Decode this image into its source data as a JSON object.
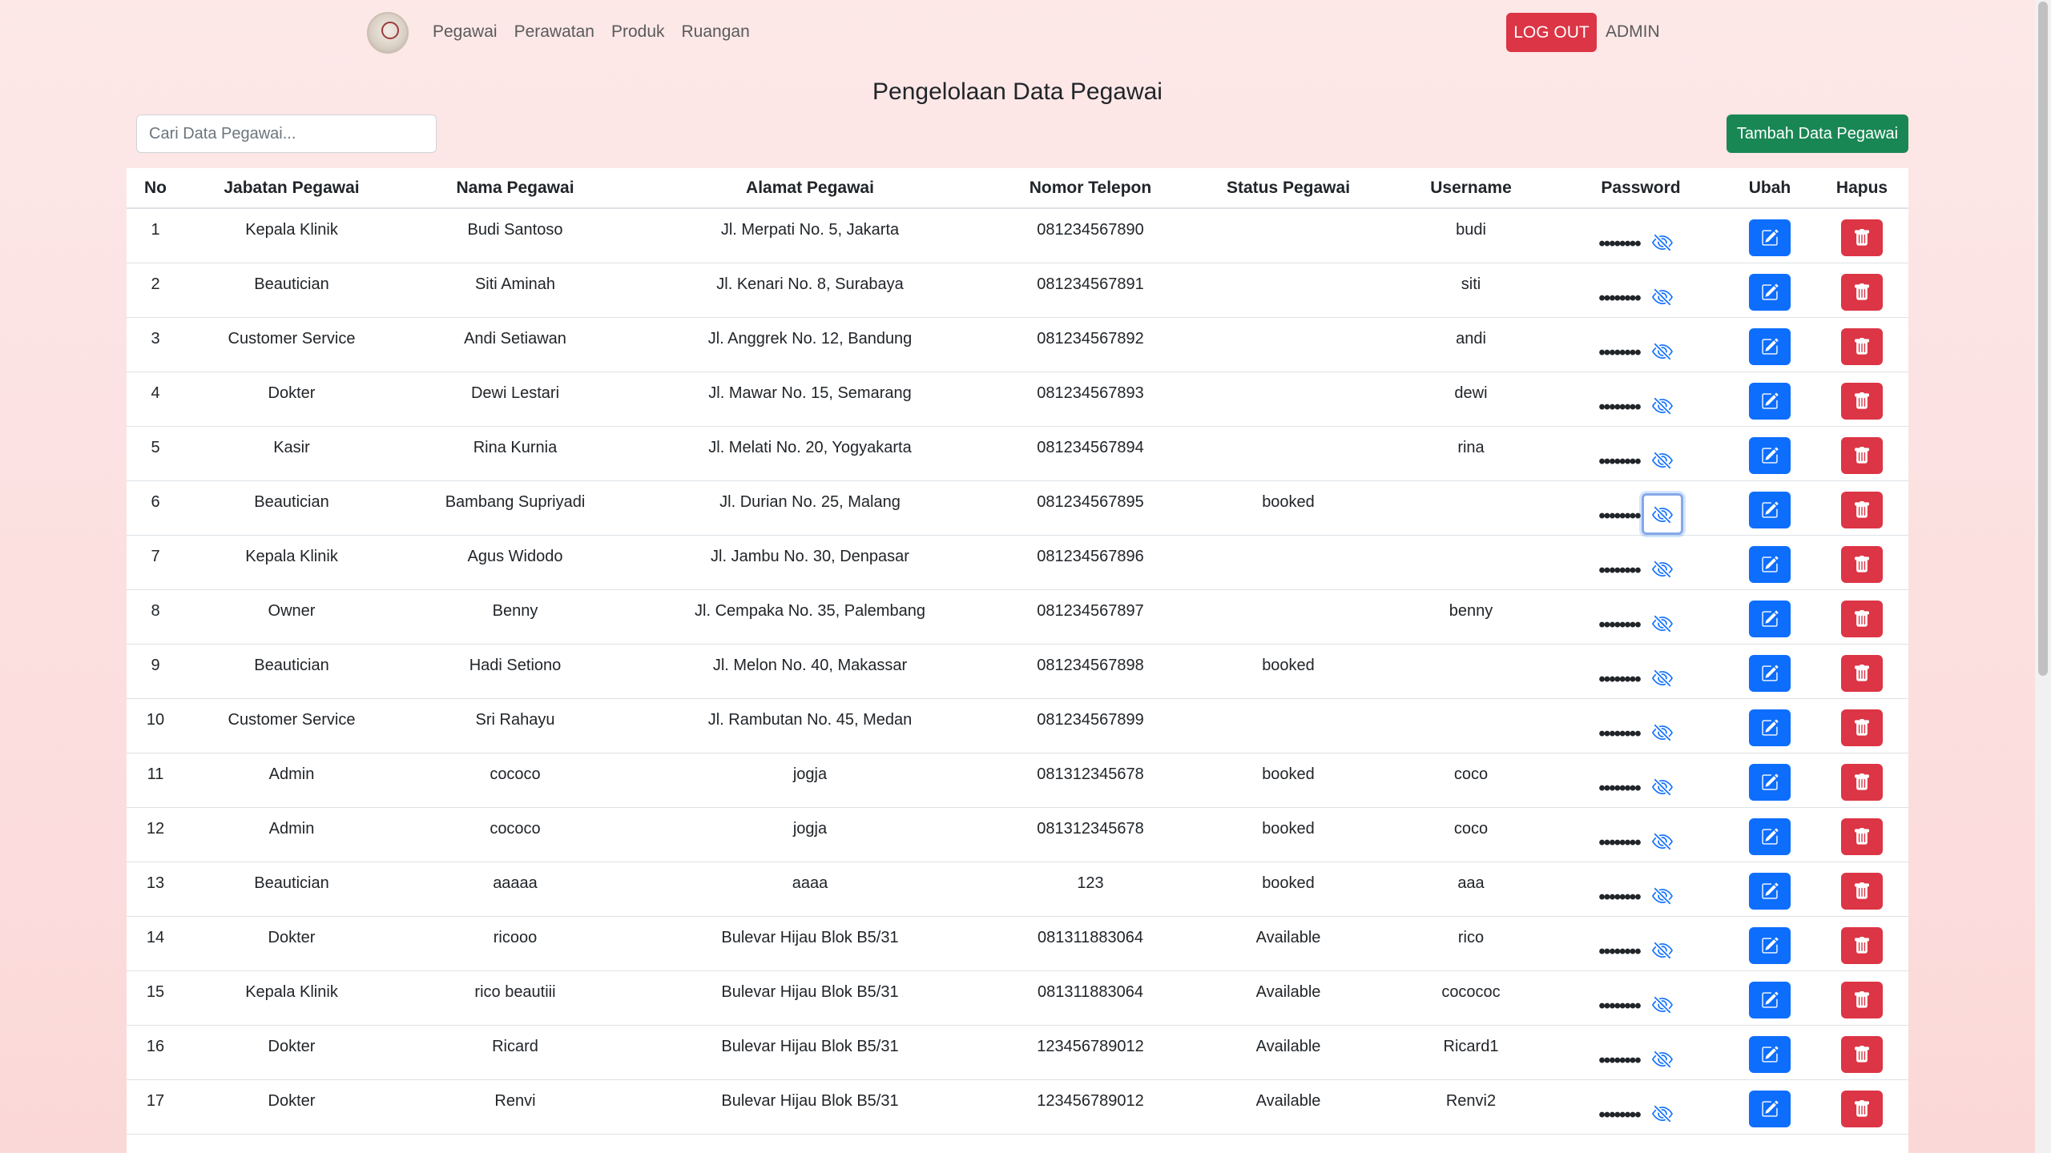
{
  "nav": {
    "links": [
      "Pegawai",
      "Perawatan",
      "Produk",
      "Ruangan"
    ],
    "logout_label": "LOG OUT",
    "user_label": "ADMIN"
  },
  "page": {
    "title": "Pengelolaan Data Pegawai",
    "search_placeholder": "Cari Data Pegawai...",
    "add_label": "Tambah Data Pegawai"
  },
  "table": {
    "headers": [
      "No",
      "Jabatan Pegawai",
      "Nama Pegawai",
      "Alamat Pegawai",
      "Nomor Telepon",
      "Status Pegawai",
      "Username",
      "Password",
      "Ubah",
      "Hapus"
    ],
    "password_mask": "••••••••",
    "rows": [
      {
        "no": "1",
        "jabatan": "Kepala Klinik",
        "nama": "Budi Santoso",
        "alamat": "Jl. Merpati No. 5, Jakarta",
        "telepon": "081234567890",
        "status": "",
        "username": "budi"
      },
      {
        "no": "2",
        "jabatan": "Beautician",
        "nama": "Siti Aminah",
        "alamat": "Jl. Kenari No. 8, Surabaya",
        "telepon": "081234567891",
        "status": "",
        "username": "siti"
      },
      {
        "no": "3",
        "jabatan": "Customer Service",
        "nama": "Andi Setiawan",
        "alamat": "Jl. Anggrek No. 12, Bandung",
        "telepon": "081234567892",
        "status": "",
        "username": "andi"
      },
      {
        "no": "4",
        "jabatan": "Dokter",
        "nama": "Dewi Lestari",
        "alamat": "Jl. Mawar No. 15, Semarang",
        "telepon": "081234567893",
        "status": "",
        "username": "dewi"
      },
      {
        "no": "5",
        "jabatan": "Kasir",
        "nama": "Rina Kurnia",
        "alamat": "Jl. Melati No. 20, Yogyakarta",
        "telepon": "081234567894",
        "status": "",
        "username": "rina"
      },
      {
        "no": "6",
        "jabatan": "Beautician",
        "nama": "Bambang Supriyadi",
        "alamat": "Jl. Durian No. 25, Malang",
        "telepon": "081234567895",
        "status": "booked",
        "username": ""
      },
      {
        "no": "7",
        "jabatan": "Kepala Klinik",
        "nama": "Agus Widodo",
        "alamat": "Jl. Jambu No. 30, Denpasar",
        "telepon": "081234567896",
        "status": "",
        "username": ""
      },
      {
        "no": "8",
        "jabatan": "Owner",
        "nama": "Benny",
        "alamat": "Jl. Cempaka No. 35, Palembang",
        "telepon": "081234567897",
        "status": "",
        "username": "benny"
      },
      {
        "no": "9",
        "jabatan": "Beautician",
        "nama": "Hadi Setiono",
        "alamat": "Jl. Melon No. 40, Makassar",
        "telepon": "081234567898",
        "status": "booked",
        "username": ""
      },
      {
        "no": "10",
        "jabatan": "Customer Service",
        "nama": "Sri Rahayu",
        "alamat": "Jl. Rambutan No. 45, Medan",
        "telepon": "081234567899",
        "status": "",
        "username": ""
      },
      {
        "no": "11",
        "jabatan": "Admin",
        "nama": "cococo",
        "alamat": "jogja",
        "telepon": "081312345678",
        "status": "booked",
        "username": "coco"
      },
      {
        "no": "12",
        "jabatan": "Admin",
        "nama": "cococo",
        "alamat": "jogja",
        "telepon": "081312345678",
        "status": "booked",
        "username": "coco"
      },
      {
        "no": "13",
        "jabatan": "Beautician",
        "nama": "aaaaa",
        "alamat": "aaaa",
        "telepon": "123",
        "status": "booked",
        "username": "aaa"
      },
      {
        "no": "14",
        "jabatan": "Dokter",
        "nama": "ricooo",
        "alamat": "Bulevar Hijau Blok B5/31",
        "telepon": "081311883064",
        "status": "Available",
        "username": "rico"
      },
      {
        "no": "15",
        "jabatan": "Kepala Klinik",
        "nama": "rico beautiii",
        "alamat": "Bulevar Hijau Blok B5/31",
        "telepon": "081311883064",
        "status": "Available",
        "username": "cocococ"
      },
      {
        "no": "16",
        "jabatan": "Dokter",
        "nama": "Ricard",
        "alamat": "Bulevar Hijau Blok B5/31",
        "telepon": "123456789012",
        "status": "Available",
        "username": "Ricard1"
      },
      {
        "no": "17",
        "jabatan": "Dokter",
        "nama": "Renvi",
        "alamat": "Bulevar Hijau Blok B5/31",
        "telepon": "123456789012",
        "status": "Available",
        "username": "Renvi2"
      }
    ]
  },
  "icons": {
    "logo": "clinic-logo",
    "toggle_password": "eye-slash-icon",
    "edit": "edit-icon",
    "delete": "trash-icon"
  },
  "colors": {
    "primary": "#0d6efd",
    "danger": "#dc3545",
    "success": "#198754"
  }
}
